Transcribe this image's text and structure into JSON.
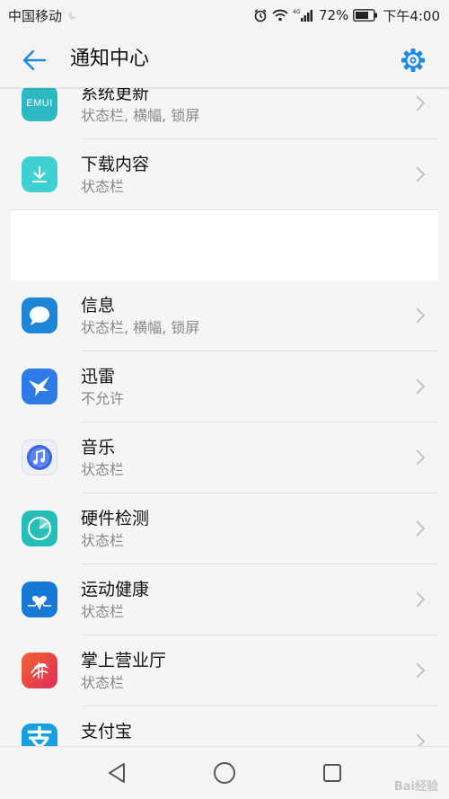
{
  "status_bar": {
    "carrier": "中国移动",
    "network": "4G",
    "battery": "72%",
    "time": "下午4:00"
  },
  "app_bar": {
    "title": "通知中心",
    "back_icon": "arrow-left-icon",
    "settings_icon": "gear-icon"
  },
  "colors": {
    "accent": "#1e88e5",
    "chevron": "#c4c4c4"
  },
  "items": [
    {
      "name": "系统更新",
      "sub": "状态栏, 横幅, 锁屏",
      "icon": "emui-icon",
      "icon_text": "EMUI"
    },
    {
      "name": "下载内容",
      "sub": "状态栏",
      "icon": "download-icon"
    },
    {
      "name": "信息",
      "sub": "状态栏, 横幅, 锁屏",
      "icon": "message-icon"
    },
    {
      "name": "迅雷",
      "sub": "不允许",
      "icon": "thunder-bird-icon"
    },
    {
      "name": "音乐",
      "sub": "状态栏",
      "icon": "music-note-icon"
    },
    {
      "name": "硬件检测",
      "sub": "状态栏",
      "icon": "hardware-check-icon"
    },
    {
      "name": "运动健康",
      "sub": "状态栏",
      "icon": "health-heart-icon"
    },
    {
      "name": "掌上营业厅",
      "sub": "状态栏",
      "icon": "china-mobile-icon"
    },
    {
      "name": "支付宝",
      "sub": "",
      "icon": "alipay-icon",
      "icon_text": "支"
    }
  ],
  "nav_bar": {
    "back_icon": "triangle-back-icon",
    "home_icon": "circle-home-icon",
    "recents_icon": "square-recents-icon"
  },
  "watermark": "Bai经验"
}
